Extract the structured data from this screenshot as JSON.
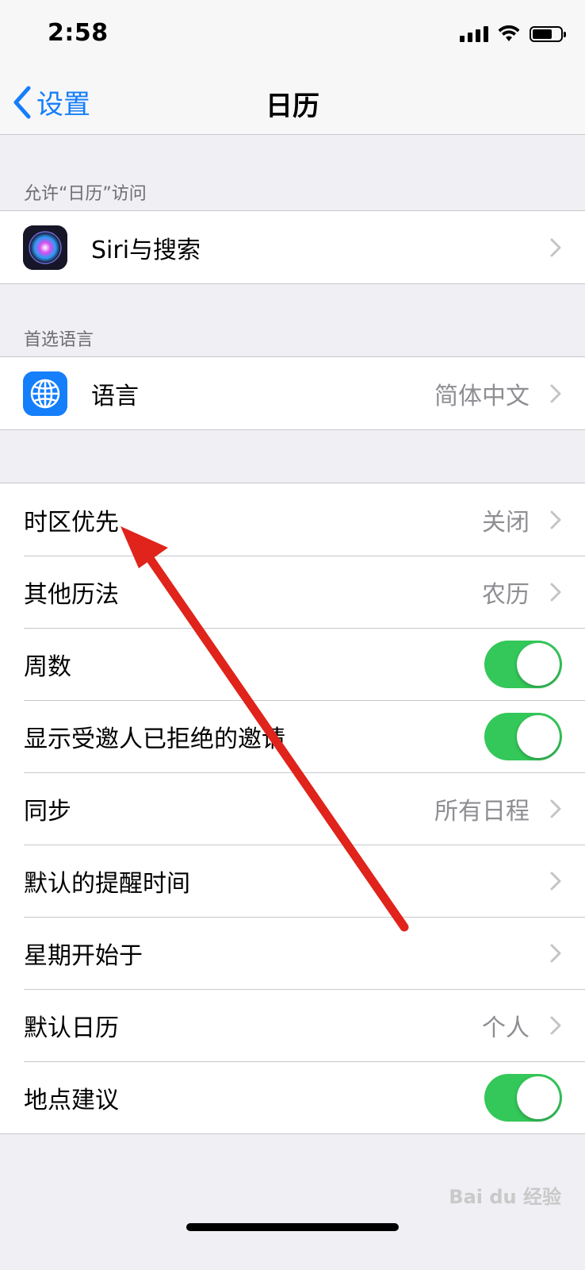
{
  "status_bar": {
    "time": "2:58"
  },
  "nav": {
    "back_label": "设置",
    "title": "日历"
  },
  "sections": {
    "allow_access_header": "允许“日历”访问",
    "siri": {
      "label": "Siri与搜索"
    },
    "preferred_language_header": "首选语言",
    "language": {
      "label": "语言",
      "value": "简体中文"
    }
  },
  "settings": {
    "timezone_override": {
      "label": "时区优先",
      "value": "关闭"
    },
    "alternate_calendars": {
      "label": "其他历法",
      "value": "农历"
    },
    "week_numbers": {
      "label": "周数",
      "enabled": true
    },
    "show_declined": {
      "label": "显示受邀人已拒绝的邀请",
      "enabled": true
    },
    "sync": {
      "label": "同步",
      "value": "所有日程"
    },
    "default_alert_times": {
      "label": "默认的提醒时间"
    },
    "start_week_on": {
      "label": "星期开始于"
    },
    "default_calendar": {
      "label": "默认日历",
      "value": "个人"
    },
    "location_suggestions": {
      "label": "地点建议",
      "enabled": true
    }
  },
  "colors": {
    "accent": "#147efb",
    "toggle_on": "#34c759",
    "annotation": "#e0231b"
  },
  "watermark": "Bai du 经验"
}
